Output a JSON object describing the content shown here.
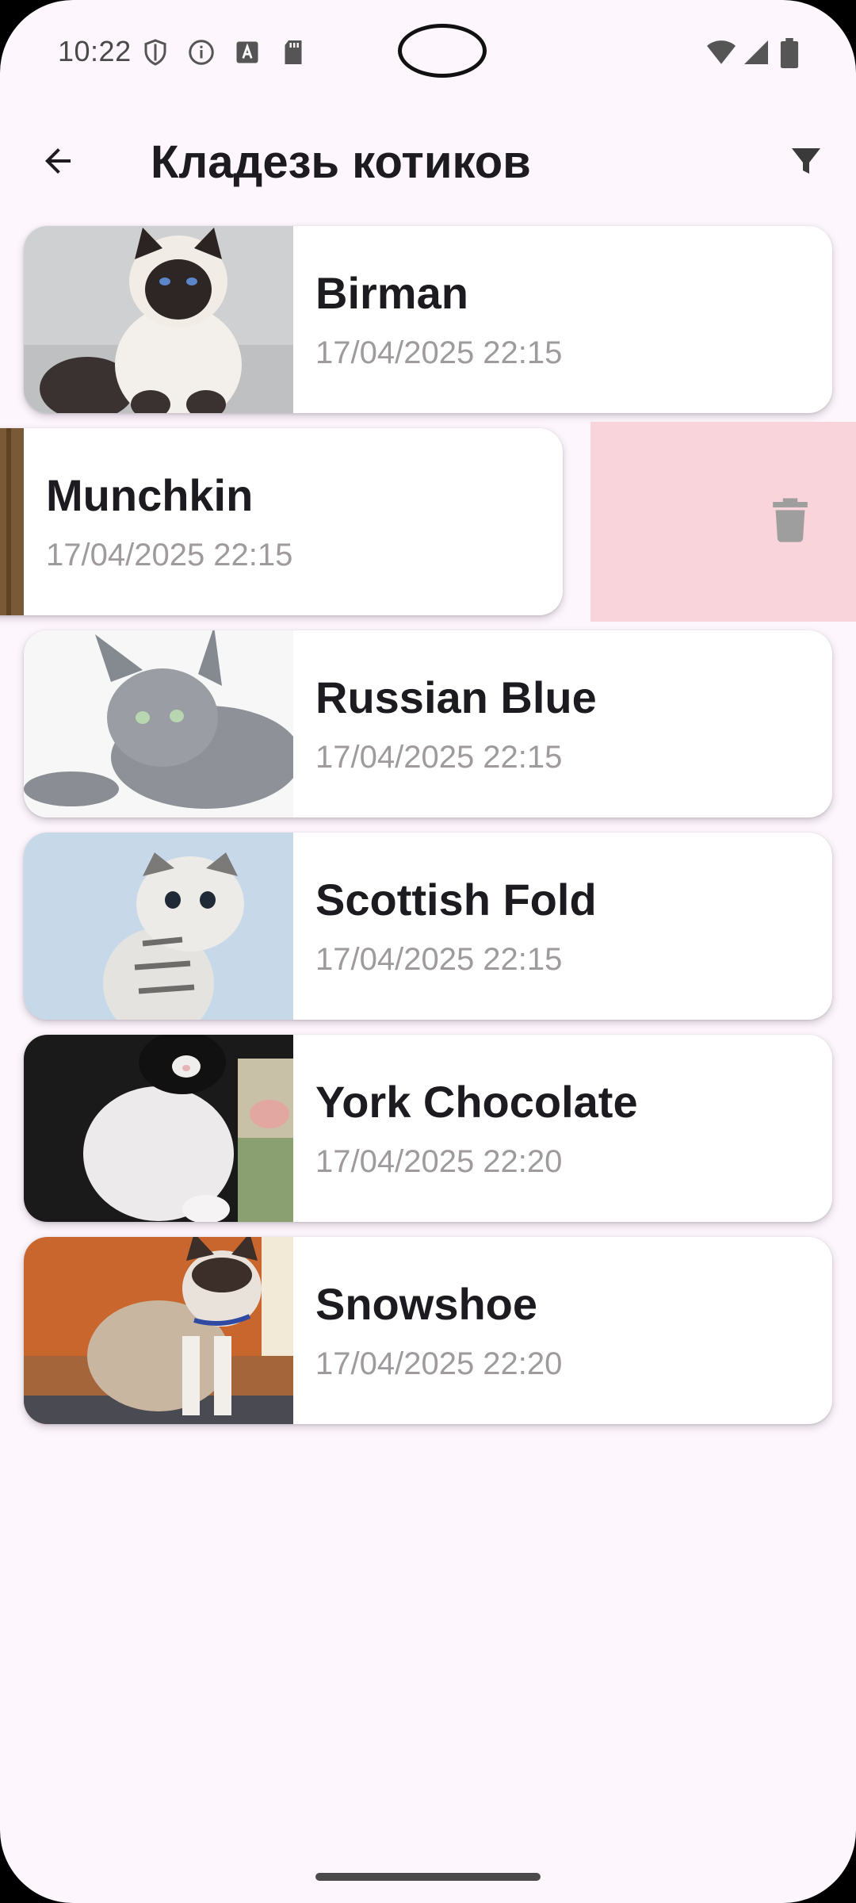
{
  "status_bar": {
    "time": "10:22",
    "icons_left": [
      "shield-icon",
      "info-icon",
      "text-a-icon",
      "sd-card-icon"
    ],
    "icons_right": [
      "wifi-icon",
      "signal-icon",
      "battery-icon"
    ]
  },
  "app_bar": {
    "title": "Кладезь котиков",
    "back_icon": "arrow-back-icon",
    "filter_icon": "filter-icon"
  },
  "cats": [
    {
      "name": "Birman",
      "date": "17/04/2025 22:15"
    },
    {
      "name": "Munchkin",
      "date": "17/04/2025 22:15",
      "swiped": true
    },
    {
      "name": "Russian Blue",
      "date": "17/04/2025 22:15"
    },
    {
      "name": "Scottish Fold",
      "date": "17/04/2025 22:15"
    },
    {
      "name": "York Chocolate",
      "date": "17/04/2025 22:20"
    },
    {
      "name": "Snowshoe",
      "date": "17/04/2025 22:20"
    }
  ],
  "colors": {
    "background": "#fdf6fc",
    "card": "#ffffff",
    "delete_background": "#fad4db",
    "delete_icon": "#9e9e9e",
    "date_text": "#9e9a9e"
  }
}
